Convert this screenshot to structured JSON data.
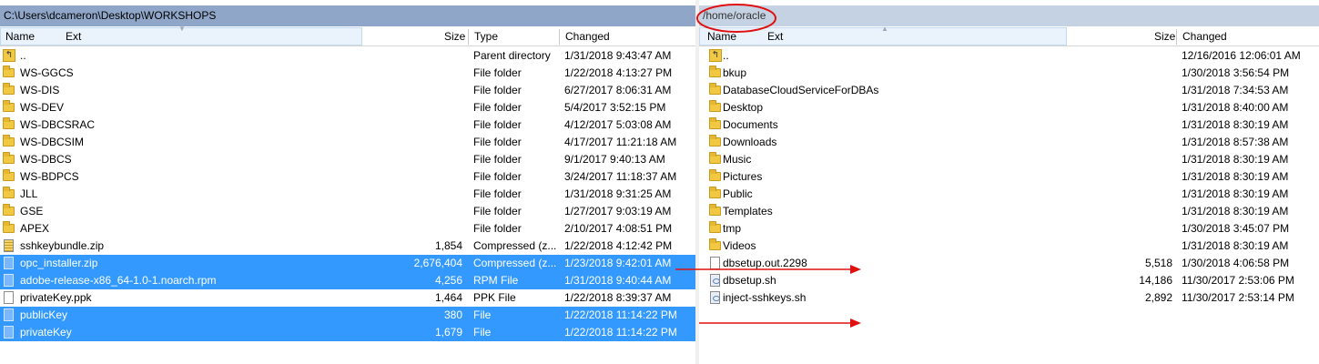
{
  "colors": {
    "selection": "#3399ff",
    "annotation": "#ff0000"
  },
  "left": {
    "path": "C:\\Users\\dcameron\\Desktop\\WORKSHOPS",
    "columns": {
      "name": "Name",
      "ext": "Ext",
      "size": "Size",
      "type": "Type",
      "changed": "Changed"
    },
    "rows": [
      {
        "icon": "up-folder-icon",
        "name": "..",
        "size": "",
        "type": "Parent directory",
        "changed": "1/31/2018  9:43:47 AM",
        "selected": false
      },
      {
        "icon": "folder-icon",
        "name": "WS-GGCS",
        "size": "",
        "type": "File folder",
        "changed": "1/22/2018  4:13:27 PM",
        "selected": false
      },
      {
        "icon": "folder-icon",
        "name": "WS-DIS",
        "size": "",
        "type": "File folder",
        "changed": "6/27/2017  8:06:31 AM",
        "selected": false
      },
      {
        "icon": "folder-icon",
        "name": "WS-DEV",
        "size": "",
        "type": "File folder",
        "changed": "5/4/2017  3:52:15 PM",
        "selected": false
      },
      {
        "icon": "folder-icon",
        "name": "WS-DBCSRAC",
        "size": "",
        "type": "File folder",
        "changed": "4/12/2017  5:03:08 AM",
        "selected": false
      },
      {
        "icon": "folder-icon",
        "name": "WS-DBCSIM",
        "size": "",
        "type": "File folder",
        "changed": "4/17/2017  11:21:18 AM",
        "selected": false
      },
      {
        "icon": "folder-icon",
        "name": "WS-DBCS",
        "size": "",
        "type": "File folder",
        "changed": "9/1/2017  9:40:13 AM",
        "selected": false
      },
      {
        "icon": "folder-icon",
        "name": "WS-BDPCS",
        "size": "",
        "type": "File folder",
        "changed": "3/24/2017  11:18:37 AM",
        "selected": false
      },
      {
        "icon": "folder-icon",
        "name": "JLL",
        "size": "",
        "type": "File folder",
        "changed": "1/31/2018  9:31:25 AM",
        "selected": false
      },
      {
        "icon": "folder-icon",
        "name": "GSE",
        "size": "",
        "type": "File folder",
        "changed": "1/27/2017  9:03:19 AM",
        "selected": false
      },
      {
        "icon": "folder-icon",
        "name": "APEX",
        "size": "",
        "type": "File folder",
        "changed": "2/10/2017  4:08:51 PM",
        "selected": false
      },
      {
        "icon": "zip-file-icon",
        "name": "sshkeybundle.zip",
        "size": "1,854",
        "type": "Compressed (z...",
        "changed": "1/22/2018  4:12:42 PM",
        "selected": false
      },
      {
        "icon": "zip-file-icon",
        "name": "opc_installer.zip",
        "size": "2,676,404",
        "type": "Compressed (z...",
        "changed": "1/23/2018  9:42:01 AM",
        "selected": true
      },
      {
        "icon": "file-icon",
        "name": "adobe-release-x86_64-1.0-1.noarch.rpm",
        "size": "4,256",
        "type": "RPM File",
        "changed": "1/31/2018  9:40:44 AM",
        "selected": true
      },
      {
        "icon": "file-icon",
        "name": "privateKey.ppk",
        "size": "1,464",
        "type": "PPK File",
        "changed": "1/22/2018  8:39:37 AM",
        "selected": false
      },
      {
        "icon": "file-icon",
        "name": "publicKey",
        "size": "380",
        "type": "File",
        "changed": "1/22/2018  11:14:22 PM",
        "selected": true
      },
      {
        "icon": "file-icon",
        "name": "privateKey",
        "size": "1,679",
        "type": "File",
        "changed": "1/22/2018  11:14:22 PM",
        "selected": true
      }
    ]
  },
  "right": {
    "path": "/home/oracle",
    "columns": {
      "name": "Name",
      "ext": "Ext",
      "size": "Size",
      "changed": "Changed"
    },
    "rows": [
      {
        "icon": "up-folder-icon",
        "name": "..",
        "size": "",
        "changed": "12/16/2016 12:06:01 AM"
      },
      {
        "icon": "folder-icon",
        "name": "bkup",
        "size": "",
        "changed": "1/30/2018 3:56:54 PM"
      },
      {
        "icon": "folder-icon",
        "name": "DatabaseCloudServiceForDBAs",
        "size": "",
        "changed": "1/31/2018 7:34:53 AM"
      },
      {
        "icon": "folder-icon",
        "name": "Desktop",
        "size": "",
        "changed": "1/31/2018 8:40:00 AM"
      },
      {
        "icon": "folder-icon",
        "name": "Documents",
        "size": "",
        "changed": "1/31/2018 8:30:19 AM"
      },
      {
        "icon": "folder-icon",
        "name": "Downloads",
        "size": "",
        "changed": "1/31/2018 8:57:38 AM"
      },
      {
        "icon": "folder-icon",
        "name": "Music",
        "size": "",
        "changed": "1/31/2018 8:30:19 AM"
      },
      {
        "icon": "folder-icon",
        "name": "Pictures",
        "size": "",
        "changed": "1/31/2018 8:30:19 AM"
      },
      {
        "icon": "folder-icon",
        "name": "Public",
        "size": "",
        "changed": "1/31/2018 8:30:19 AM"
      },
      {
        "icon": "folder-icon",
        "name": "Templates",
        "size": "",
        "changed": "1/31/2018 8:30:19 AM"
      },
      {
        "icon": "folder-icon",
        "name": "tmp",
        "size": "",
        "changed": "1/30/2018 3:45:07 PM"
      },
      {
        "icon": "folder-icon",
        "name": "Videos",
        "size": "",
        "changed": "1/31/2018 8:30:19 AM"
      },
      {
        "icon": "file-icon",
        "name": "dbsetup.out.2298",
        "size": "5,518",
        "changed": "1/30/2018 4:06:58 PM"
      },
      {
        "icon": "script-file-icon",
        "name": "dbsetup.sh",
        "size": "14,186",
        "changed": "11/30/2017 2:53:06 PM"
      },
      {
        "icon": "script-file-icon",
        "name": "inject-sshkeys.sh",
        "size": "2,892",
        "changed": "11/30/2017 2:53:14 PM"
      }
    ]
  }
}
